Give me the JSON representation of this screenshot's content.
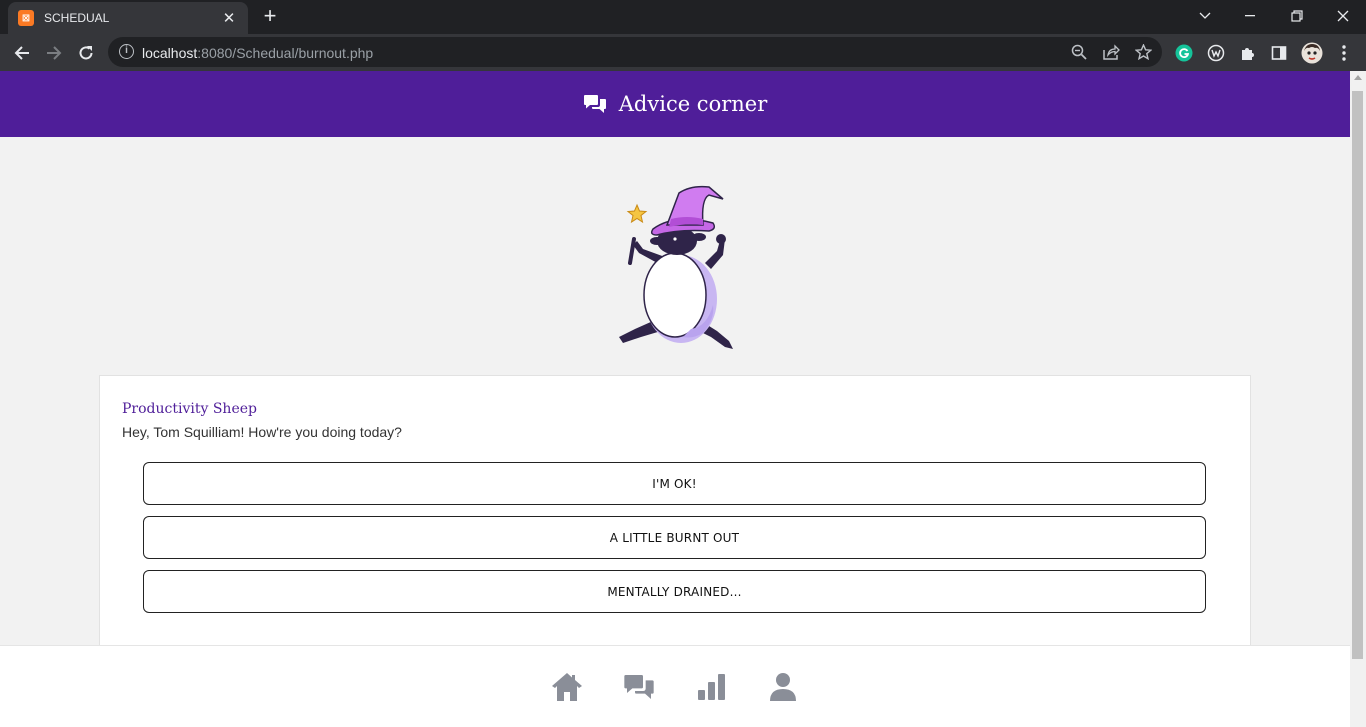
{
  "browser": {
    "tab_title": "SCHEDUAL",
    "favicon_text": "⊠",
    "url_host": "localhost",
    "url_rest": ":8080/Schedual/burnout.php",
    "info_glyph": "i"
  },
  "header": {
    "title": "Advice corner",
    "icon": "comments-icon",
    "background": "#4f1e99"
  },
  "chat": {
    "speaker": "Productivity Sheep",
    "message": "Hey, Tom Squilliam! How're you doing today?",
    "choices": [
      "I'M OK!",
      "A LITTLE BURNT OUT",
      "MENTALLY DRAINED..."
    ]
  },
  "bottom_nav": {
    "items": [
      "home-icon",
      "comments-icon",
      "chart-bar-icon",
      "user-icon"
    ],
    "icon_color": "#8a8e98"
  }
}
